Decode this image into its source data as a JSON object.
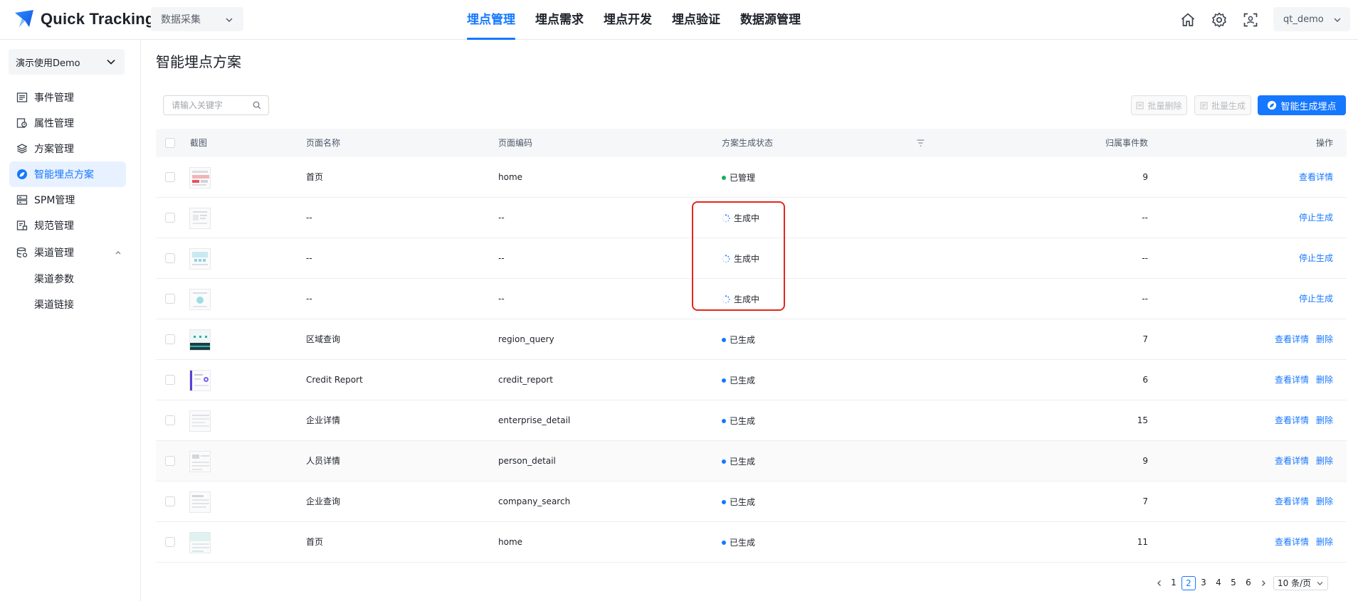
{
  "app": {
    "name": "Quick Tracking",
    "module": "数据采集"
  },
  "nav": {
    "items": [
      "埋点管理",
      "埋点需求",
      "埋点开发",
      "埋点验证",
      "数据源管理"
    ],
    "active": "埋点管理"
  },
  "header_icons": [
    "home-icon",
    "settings-icon",
    "scan-icon"
  ],
  "user": {
    "name": "qt_demo"
  },
  "sidebar": {
    "project": "演示使用Demo",
    "items": [
      {
        "label": "事件管理",
        "icon": "event-list-icon"
      },
      {
        "label": "属性管理",
        "icon": "property-icon"
      },
      {
        "label": "方案管理",
        "icon": "layers-icon"
      },
      {
        "label": "智能埋点方案",
        "icon": "smart-track-icon",
        "active": true
      },
      {
        "label": "SPM管理",
        "icon": "spm-icon"
      },
      {
        "label": "规范管理",
        "icon": "spec-icon"
      },
      {
        "label": "渠道管理",
        "icon": "channel-icon",
        "expanded": true
      }
    ],
    "sub_items": [
      "渠道参数",
      "渠道链接"
    ]
  },
  "page": {
    "title": "智能埋点方案",
    "search_placeholder": "请输入关键字",
    "batch_delete": "批量删除",
    "batch_generate": "批量生成",
    "smart_generate": "智能生成埋点"
  },
  "table": {
    "columns": [
      "截图",
      "页面名称",
      "页面编码",
      "方案生成状态",
      "归属事件数",
      "操作"
    ],
    "rows": [
      {
        "name": "首页",
        "code": "home",
        "status": "已管理",
        "status_type": "managed",
        "events": "9",
        "actions": [
          "查看详情"
        ]
      },
      {
        "name": "--",
        "code": "--",
        "status": "生成中",
        "status_type": "generating",
        "events": "--",
        "actions": [
          "停止生成"
        ]
      },
      {
        "name": "--",
        "code": "--",
        "status": "生成中",
        "status_type": "generating",
        "events": "--",
        "actions": [
          "停止生成"
        ]
      },
      {
        "name": "--",
        "code": "--",
        "status": "生成中",
        "status_type": "generating",
        "events": "--",
        "actions": [
          "停止生成"
        ]
      },
      {
        "name": "区域查询",
        "code": "region_query",
        "status": "已生成",
        "status_type": "generated",
        "events": "7",
        "actions": [
          "查看详情",
          "删除"
        ]
      },
      {
        "name": "Credit Report",
        "code": "credit_report",
        "status": "已生成",
        "status_type": "generated",
        "events": "6",
        "actions": [
          "查看详情",
          "删除"
        ]
      },
      {
        "name": "企业详情",
        "code": "enterprise_detail",
        "status": "已生成",
        "status_type": "generated",
        "events": "15",
        "actions": [
          "查看详情",
          "删除"
        ]
      },
      {
        "name": "人员详情",
        "code": "person_detail",
        "status": "已生成",
        "status_type": "generated",
        "events": "9",
        "actions": [
          "查看详情",
          "删除"
        ]
      },
      {
        "name": "企业查询",
        "code": "company_search",
        "status": "已生成",
        "status_type": "generated",
        "events": "7",
        "actions": [
          "查看详情",
          "删除"
        ]
      },
      {
        "name": "首页",
        "code": "home",
        "status": "已生成",
        "status_type": "generated",
        "events": "11",
        "actions": [
          "查看详情",
          "删除"
        ]
      }
    ]
  },
  "pagination": {
    "pages": [
      "1",
      "2",
      "3",
      "4",
      "5",
      "6"
    ],
    "current": "2",
    "page_size": "10 条/页"
  },
  "colors": {
    "primary": "#1677ff",
    "managed": "#16b35a",
    "generated": "#1677ff",
    "highlight": "#e3261c"
  }
}
